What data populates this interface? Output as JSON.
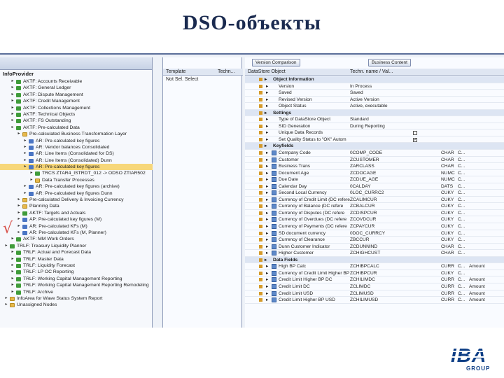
{
  "slide": {
    "title": "DSO-объекты"
  },
  "left": {
    "title": "InfoProvider",
    "rows": [
      {
        "text": "AKTF: Accounts Receivable",
        "indent": 1,
        "icon": "green"
      },
      {
        "text": "AKTF: General Ledger",
        "indent": 1,
        "icon": "green"
      },
      {
        "text": "AKTF: Dispute Management",
        "indent": 1,
        "icon": "green"
      },
      {
        "text": "AKTF: Credit Management",
        "indent": 1,
        "icon": "green"
      },
      {
        "text": "AKTF: Collections Management",
        "indent": 1,
        "icon": "green"
      },
      {
        "text": "AKTF: Technical Objects",
        "indent": 1,
        "icon": "green"
      },
      {
        "text": "AKTF: FS Outstanding",
        "indent": 1,
        "icon": "green"
      },
      {
        "text": "AKTF: Pre-calculated Data",
        "indent": 1,
        "icon": "green"
      },
      {
        "text": "Pre-calculated Business Transformation Layer",
        "indent": 2,
        "icon": "yellow"
      },
      {
        "text": "AR: Pre-calculated key figures",
        "indent": 3,
        "icon": "blue"
      },
      {
        "text": "AR: Vendor balances Consolidated",
        "indent": 3,
        "icon": "blue"
      },
      {
        "text": "AR: Line Items (Consolidated for DS)",
        "indent": 3,
        "icon": "blue"
      },
      {
        "text": "AR: Line Items (Consolidated) Dunn",
        "indent": 3,
        "icon": "blue"
      },
      {
        "text": "AR: Pre-calculated key figures",
        "indent": 3,
        "icon": "blue",
        "selected": true
      },
      {
        "text": "TRCS ZTAR4_ISTRDT_012 -> ODSO ZTIAR502",
        "indent": 4,
        "icon": "green"
      },
      {
        "text": "Data Transfer Processes",
        "indent": 4,
        "icon": "yellow"
      },
      {
        "text": "AR: Pre-calculated key figures (archive)",
        "indent": 3,
        "icon": "blue"
      },
      {
        "text": "AR: Pre-calculated key figures Dunn",
        "indent": 3,
        "icon": "blue"
      },
      {
        "text": "Pre-calculated Delivery & Invoicing Currency",
        "indent": 2,
        "icon": "yellow"
      },
      {
        "text": "Planning Data",
        "indent": 2,
        "icon": "yellow"
      },
      {
        "text": "AKTF: Targets and Actuals",
        "indent": 2,
        "icon": "green"
      },
      {
        "text": "AP: Pre-calculated key figures (M)",
        "indent": 2,
        "icon": "blue"
      },
      {
        "text": "AR: Pre-calculated KFs (M)",
        "indent": 2,
        "icon": "blue"
      },
      {
        "text": "AR: Pre-calculated KFs (M, Planner)",
        "indent": 2,
        "icon": "blue"
      },
      {
        "text": "AKTF: MM Work Orders",
        "indent": 1,
        "icon": "green"
      },
      {
        "text": "TRLF: Treasury Liquidity Planner",
        "indent": 0,
        "icon": "green"
      },
      {
        "text": "TRLF: Actual and Forecast Data",
        "indent": 1,
        "icon": "green"
      },
      {
        "text": "TRLF: Master Data",
        "indent": 1,
        "icon": "green"
      },
      {
        "text": "TRLF: Liquidity Forecast",
        "indent": 1,
        "icon": "green"
      },
      {
        "text": "TRLF: LP OC Reporting",
        "indent": 1,
        "icon": "green"
      },
      {
        "text": "TRLF: Working Capital Management Reporting",
        "indent": 1,
        "icon": "green"
      },
      {
        "text": "TRLF: Working Capital Management Reporting Remodeling",
        "indent": 1,
        "icon": "green"
      },
      {
        "text": "TRLF: Archive",
        "indent": 1,
        "icon": "green"
      },
      {
        "text": "InfoArea for Wave Status System Report",
        "indent": 0,
        "icon": "yellow"
      },
      {
        "text": "Unassigned Nodes",
        "indent": 0,
        "icon": "yellow"
      }
    ]
  },
  "middle": {
    "col_template": "Template",
    "col_tech": "Techn...",
    "row": "Not Sel. Select"
  },
  "right": {
    "buttons": {
      "version": "Version Comparison",
      "business": "Business Content"
    },
    "col_object": "DataStore Object",
    "col_techname": "Techn. name / Val...",
    "rows": [
      {
        "kind": "section",
        "text": "Object Information",
        "indent": 2
      },
      {
        "kind": "item",
        "text": "Version",
        "value": "In Process",
        "indent": 3
      },
      {
        "kind": "item",
        "text": "Saved",
        "value": "Saved",
        "indent": 3
      },
      {
        "kind": "item",
        "text": "Revised Version",
        "value": "Active Version",
        "indent": 3
      },
      {
        "kind": "item",
        "text": "Object Status",
        "value": "Active, executable",
        "indent": 3
      },
      {
        "kind": "section",
        "text": "Settings",
        "indent": 2
      },
      {
        "kind": "item",
        "text": "Type of DataStore Object",
        "value": "Standard",
        "indent": 3
      },
      {
        "kind": "item",
        "text": "SID Generation",
        "value": "During Reporting",
        "indent": 3
      },
      {
        "kind": "item",
        "text": "Unique Data Records",
        "value": "",
        "indent": 3,
        "check": false
      },
      {
        "kind": "item",
        "text": "Set Quality Status to \"OK\" Autom",
        "value": "",
        "indent": 3,
        "check": true
      },
      {
        "kind": "section",
        "text": "Keyfields",
        "indent": 2
      },
      {
        "kind": "field",
        "text": "Company Code",
        "tech": "0COMP_CODE",
        "type": "CHAR",
        "c": "C..."
      },
      {
        "kind": "field",
        "text": "Customer",
        "tech": "ZCUSTOMER",
        "type": "CHAR",
        "c": "C..."
      },
      {
        "kind": "field",
        "text": "Business Trans",
        "tech": "ZARCLASS",
        "type": "CHAR",
        "c": "C..."
      },
      {
        "kind": "field",
        "text": "Document Age",
        "tech": "ZCDOCAGE",
        "type": "NUMC",
        "c": "C..."
      },
      {
        "kind": "field",
        "text": "Due Date",
        "tech": "ZCDUE_AGE",
        "type": "NUMC",
        "c": "C..."
      },
      {
        "kind": "field",
        "text": "Calendar Day",
        "tech": "0CALDAY",
        "type": "DATS",
        "c": "C..."
      },
      {
        "kind": "field",
        "text": "Second Local Currency",
        "tech": "0LOC_CURRC2",
        "type": "CUKY",
        "c": "C..."
      },
      {
        "kind": "field",
        "text": "Currency of Credit Limit (DC refere",
        "tech": "ZCALIMCUR",
        "type": "CUKY",
        "c": "C..."
      },
      {
        "kind": "field",
        "text": "Currency of Balance (DC refere",
        "tech": "ZCBALCUR",
        "type": "CUKY",
        "c": "C..."
      },
      {
        "kind": "field",
        "text": "Currency of Disputes (DC refere",
        "tech": "ZCDISPCUR",
        "type": "CUKY",
        "c": "C..."
      },
      {
        "kind": "field",
        "text": "Currency of Overdues (DC refere",
        "tech": "ZCOVDCUR",
        "type": "CUKY",
        "c": "C..."
      },
      {
        "kind": "field",
        "text": "Currency of Payments (DC refere",
        "tech": "ZCPAYCUR",
        "type": "CUKY",
        "c": "C..."
      },
      {
        "kind": "field",
        "text": "SD document currency",
        "tech": "0DOC_CURRCY",
        "type": "CUKY",
        "c": "C..."
      },
      {
        "kind": "field",
        "text": "Currency of Clearance",
        "tech": "ZBCCUR",
        "type": "CUKY",
        "c": "C..."
      },
      {
        "kind": "field",
        "text": "Dunn Customer Indicator",
        "tech": "ZCDUNNIND",
        "type": "CHAR",
        "c": "C..."
      },
      {
        "kind": "field",
        "text": "Higher Customer",
        "tech": "ZCHIGHCUST",
        "type": "CHAR",
        "c": "C..."
      },
      {
        "kind": "section",
        "text": "Data Fields",
        "indent": 2
      },
      {
        "kind": "data",
        "text": "High BP Calc",
        "tech": "ZCHIBPCALC",
        "type": "CURR",
        "c": "C...",
        "extra": "Amount"
      },
      {
        "kind": "data",
        "text": "Currency of Credit Limit Higher BP",
        "tech": "ZCHIBPCUR",
        "type": "CUKY",
        "c": "C...",
        "extra": ""
      },
      {
        "kind": "data",
        "text": "Credit Limit Higher BP DC",
        "tech": "ZCHILIMDC",
        "type": "CURR",
        "c": "C...",
        "extra": "Amount"
      },
      {
        "kind": "data",
        "text": "Credit Limit DC",
        "tech": "ZCLIMDC",
        "type": "CURR",
        "c": "C...",
        "extra": "Amount"
      },
      {
        "kind": "data",
        "text": "Credit Limit USD",
        "tech": "ZCLIMUSD",
        "type": "CURR",
        "c": "C...",
        "extra": "Amount"
      },
      {
        "kind": "data",
        "text": "Credit Limit Higher BP USD",
        "tech": "ZCHILIMUSD",
        "type": "CURR",
        "c": "C...",
        "extra": "Amount"
      }
    ]
  },
  "logo": {
    "main": "IBA",
    "sub": "GROUP"
  },
  "colors": {
    "title": "#1a2a4f",
    "logo": "#0f3f86",
    "selection": "#f7d77a"
  },
  "icons": [
    "tree-arrow-icon",
    "folder-icon",
    "cube-icon",
    "field-icon",
    "checkbox-icon",
    "check-mark-icon"
  ]
}
